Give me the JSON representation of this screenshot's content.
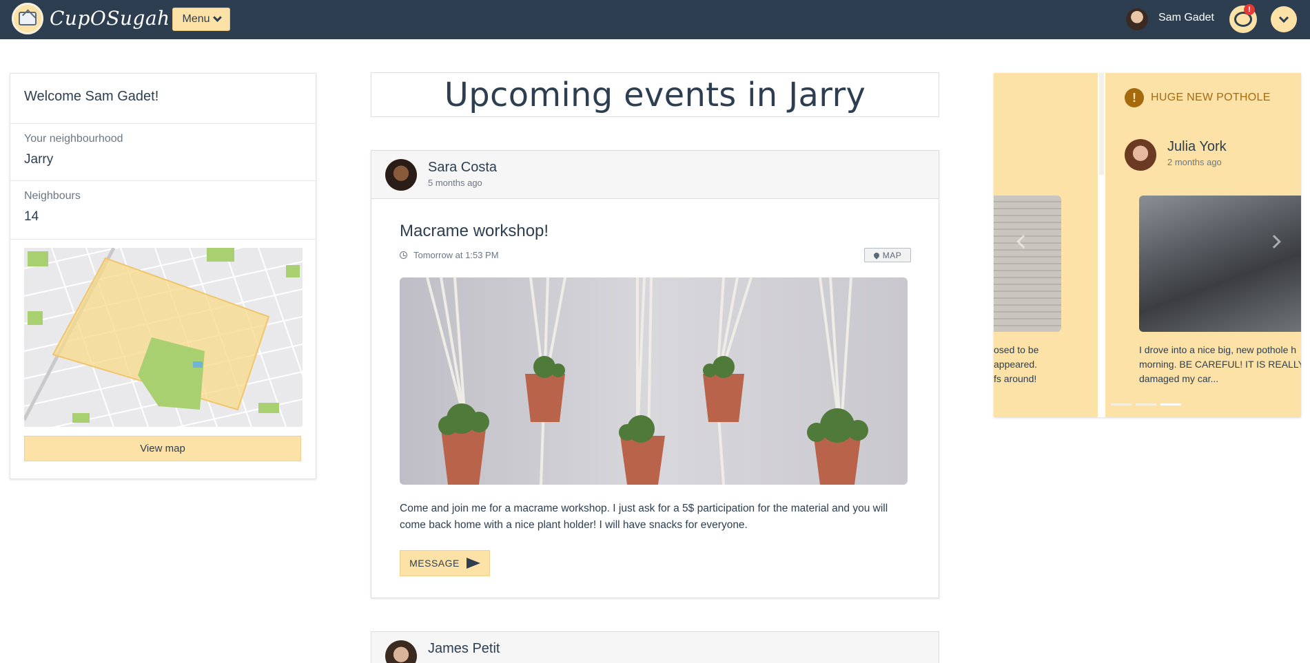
{
  "header": {
    "brand": "CupOSugah",
    "menu_label": "Menu",
    "user_name": "Sam Gadet",
    "notification_count": "!"
  },
  "sidebar": {
    "welcome": "Welcome Sam Gadet!",
    "neighbourhood_label": "Your neighbourhood",
    "neighbourhood": "Jarry",
    "neighbours_label": "Neighbours",
    "neighbours_count": "14",
    "view_map_label": "View map"
  },
  "main": {
    "title": "Upcoming events in Jarry",
    "posts": [
      {
        "author": "Sara Costa",
        "time": "5 months ago",
        "title": "Macrame workshop!",
        "when": "Tomorrow at 1:53 PM",
        "map_label": "MAP",
        "description": "Come and join me for a macrame workshop. I just ask for a 5$ participation for the material and you will come back home with a nice plant holder! I will have snacks for everyone.",
        "message_label": "MESSAGE"
      },
      {
        "author": "James Petit",
        "time": ""
      }
    ]
  },
  "alerts": {
    "prev_text": [
      "osed to be",
      "appeared.",
      "fs around!"
    ],
    "current": {
      "title": "HUGE NEW POTHOLE",
      "author": "Julia York",
      "time": "2 months ago",
      "text": "I drove into a nice big, new pothole h morning. BE CAREFUL! IT IS REALLY damaged my car..."
    },
    "slides_total": 3,
    "active_slide": 3
  },
  "colors": {
    "navbar": "#2c3e50",
    "accent": "#fde2a8",
    "alert_text": "#a5690e",
    "text": "#2c3e50"
  }
}
